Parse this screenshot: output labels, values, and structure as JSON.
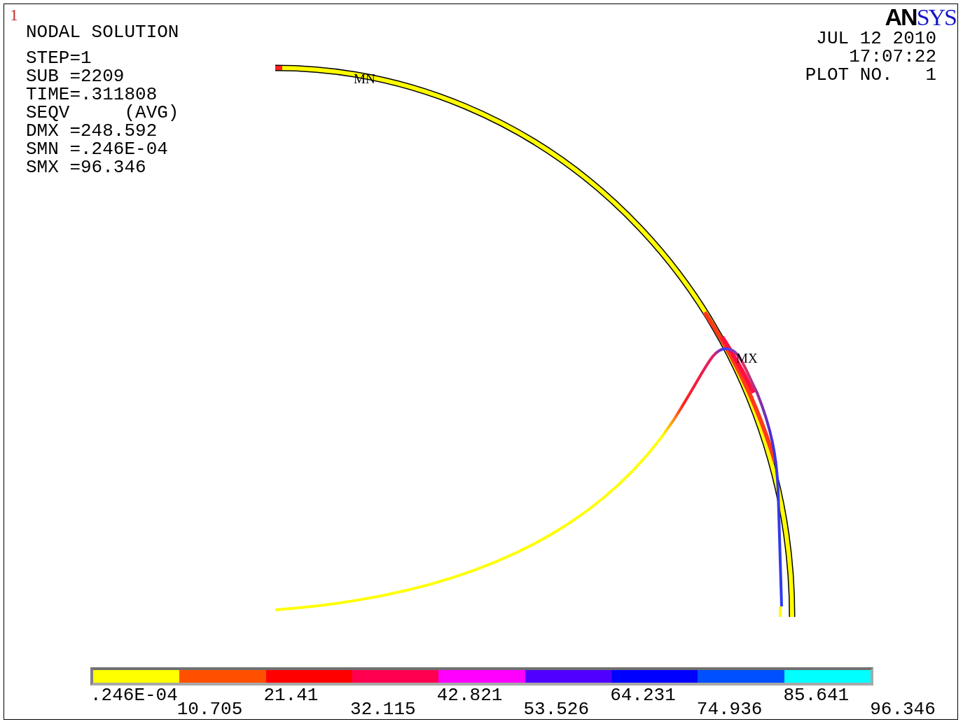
{
  "window_number": "1",
  "title": "NODAL SOLUTION",
  "parameters": [
    "STEP=1",
    "SUB =2209",
    "TIME=.311808",
    "SEQV     (AVG)",
    "DMX =248.592",
    "SMN =.246E-04",
    "SMX =96.346"
  ],
  "logo": {
    "dark": "AN",
    "blue": "SYS"
  },
  "date": "JUL 12 2010",
  "time": "17:07:22",
  "plot_number": "PLOT NO.   1",
  "markers": [
    {
      "kind": "min",
      "label": "MN"
    },
    {
      "kind": "max",
      "label": "MX"
    }
  ],
  "legend": {
    "bands": [
      {
        "color": "#ffff00"
      },
      {
        "color": "#ff5000"
      },
      {
        "color": "#ff0000"
      },
      {
        "color": "#ff0050"
      },
      {
        "color": "#ff00ff"
      },
      {
        "color": "#5000ff"
      },
      {
        "color": "#0000ff"
      },
      {
        "color": "#0050ff"
      },
      {
        "color": "#00ffff"
      }
    ],
    "labels": [
      ".246E-04",
      "10.705",
      "21.41",
      "32.115",
      "42.821",
      "53.526",
      "64.231",
      "74.936",
      "85.641",
      "96.346"
    ]
  }
}
